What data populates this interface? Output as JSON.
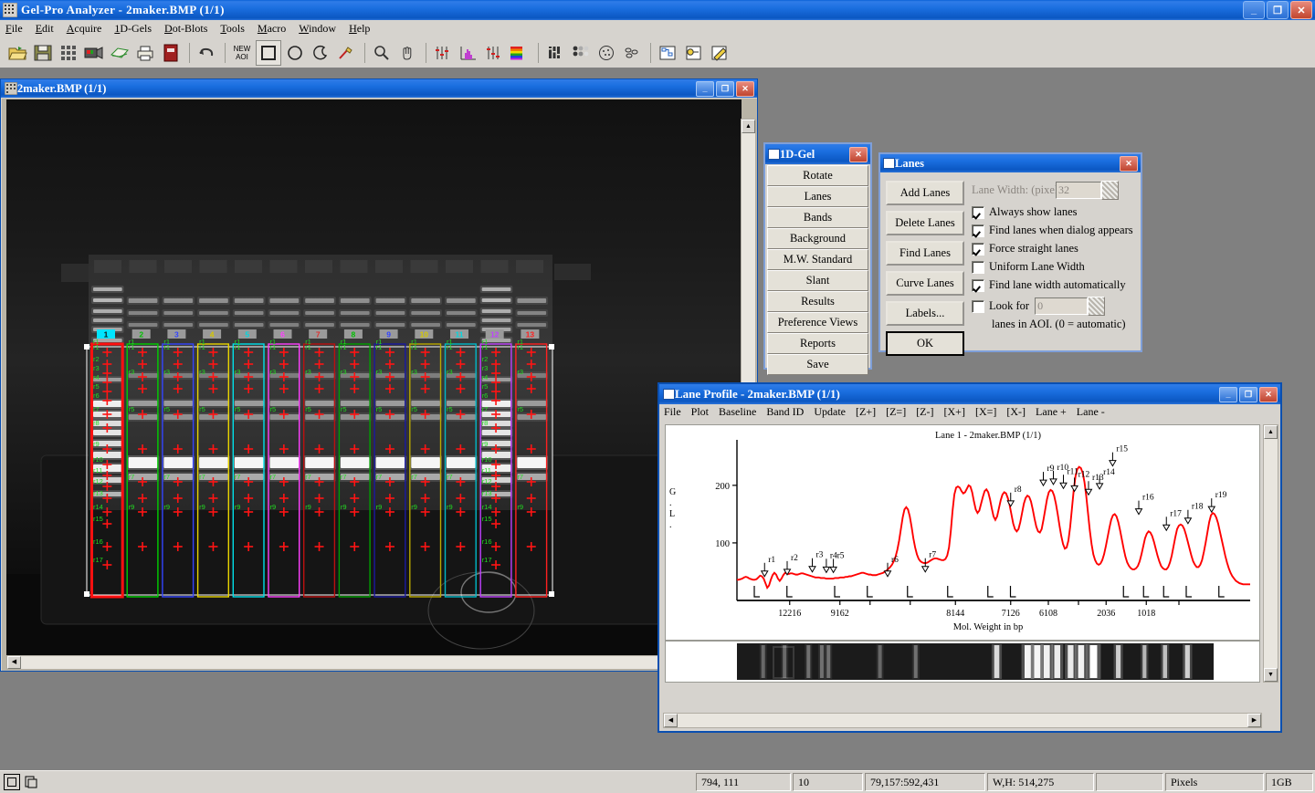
{
  "app": {
    "title": "Gel-Pro Analyzer - 2maker.BMP (1/1)",
    "icon": "gel-app-icon",
    "window_buttons": {
      "minimize": "_",
      "restore": "❐",
      "close": "✕"
    },
    "menu": [
      "File",
      "Edit",
      "Acquire",
      "1D-Gels",
      "Dot-Blots",
      "Tools",
      "Macro",
      "Window",
      "Help"
    ],
    "toolbar": [
      {
        "name": "open-icon",
        "glyph": "📂"
      },
      {
        "name": "save-icon",
        "glyph": "💾"
      },
      {
        "name": "grid-icon",
        "glyph": "▒"
      },
      {
        "name": "camera-icon",
        "glyph": "📷"
      },
      {
        "name": "scanner-icon",
        "glyph": "▱"
      },
      {
        "name": "print-icon",
        "glyph": "🖶"
      },
      {
        "name": "book-icon",
        "glyph": "📕"
      },
      {
        "name": "undo-icon",
        "glyph": "↩"
      },
      {
        "name": "new-aoi-icon",
        "glyph": "NEW AOI"
      },
      {
        "name": "rect-aoi-icon",
        "glyph": "□"
      },
      {
        "name": "ellipse-aoi-icon",
        "glyph": "◯"
      },
      {
        "name": "irregular-aoi-icon",
        "glyph": "☾"
      },
      {
        "name": "freehand-aoi-icon",
        "glyph": "✎"
      },
      {
        "name": "zoom-icon",
        "glyph": "🔍"
      },
      {
        "name": "pan-hand-icon",
        "glyph": "✋"
      },
      {
        "name": "contrast-icon",
        "glyph": "↕"
      },
      {
        "name": "histogram-icon",
        "glyph": "░"
      },
      {
        "name": "levels-icon",
        "glyph": "↕"
      },
      {
        "name": "lut-color-icon",
        "glyph": "☰"
      },
      {
        "name": "1d-gel-icon",
        "glyph": "▓"
      },
      {
        "name": "dot-blot-icon",
        "glyph": "⚫"
      },
      {
        "name": "colony-count-icon",
        "glyph": "◎"
      },
      {
        "name": "object-count-icon",
        "glyph": "◌"
      },
      {
        "name": "macro-icon",
        "glyph": "⌗"
      },
      {
        "name": "script-icon",
        "glyph": "📝"
      },
      {
        "name": "annotate-icon",
        "glyph": "✏"
      }
    ]
  },
  "gel_window": {
    "title": "2maker.BMP  (1/1)",
    "icon": "image-document-icon",
    "buttons": {
      "minimize": "_",
      "restore": "❐",
      "close": "✕"
    },
    "lane_labels": [
      "1",
      "2",
      "3",
      "4",
      "5",
      "6",
      "7",
      "8",
      "9",
      "10",
      "11",
      "12",
      "13"
    ],
    "lane_label_colors": [
      "#00e5ff",
      "#00c000",
      "#3344ff",
      "#d6c800",
      "#00d8e0",
      "#ff40ff",
      "#e03030",
      "#00c000",
      "#3344ff",
      "#d6c800",
      "#00d8e0",
      "#c040ff",
      "#ff2020"
    ],
    "lane_outline_colors": [
      "#ff1010",
      "#00d000",
      "#3344ff",
      "#e8d400",
      "#00e0ea",
      "#ff40ff",
      "#bb1010",
      "#00a000",
      "#1a1aa0",
      "#b8a800",
      "#00b8c8",
      "#c040ff",
      "#ff2020"
    ],
    "selected_lane": 1,
    "band_tag_prefix": "r"
  },
  "gel_dialog": {
    "title": "1D-Gel",
    "icon": "dialog-icon",
    "close": "✕",
    "buttons": [
      "Rotate",
      "Lanes",
      "Bands",
      "Background",
      "M.W. Standard",
      "Slant",
      "Results",
      "Preference Views",
      "Reports",
      "Save"
    ]
  },
  "lanes_dialog": {
    "title": "Lanes",
    "icon": "dialog-icon",
    "close": "✕",
    "buttons": [
      "Add Lanes",
      "Delete Lanes",
      "Find Lanes",
      "Curve Lanes",
      "Labels...",
      "OK"
    ],
    "lane_width_label": "Lane Width:  (pixels)",
    "lane_width_value": "32",
    "checkboxes": [
      {
        "label": "Always show lanes",
        "checked": true
      },
      {
        "label": "Find lanes when dialog appears",
        "checked": true
      },
      {
        "label": "Force straight lanes",
        "checked": true
      },
      {
        "label": "Uniform Lane Width",
        "checked": false
      },
      {
        "label": "Find lane width automatically",
        "checked": true
      },
      {
        "label": "Look for",
        "checked": false
      }
    ],
    "look_for_value": "0",
    "aoi_note": "lanes in AOI.  (0 = automatic)"
  },
  "lane_profile": {
    "title": "Lane Profile - 2maker.BMP (1/1)",
    "icon": "profile-icon",
    "buttons": {
      "minimize": "_",
      "restore": "❐",
      "close": "✕"
    },
    "menu": [
      "File",
      "Plot",
      "Baseline",
      "Band ID",
      "Update",
      "[Z+]",
      "[Z=]",
      "[Z-]",
      "[X+]",
      "[X=]",
      "[X-]",
      "Lane +",
      "Lane -"
    ]
  },
  "chart_data": {
    "type": "line",
    "title": "Lane 1 - 2maker.BMP  (1/1)",
    "xlabel": "Mol. Weight in bp",
    "ylabel": "G.L.",
    "ylim": [
      0,
      260
    ],
    "yticks": [
      100,
      200
    ],
    "xtick_labels": [
      "12216",
      "9162",
      "8144",
      "7126",
      "6108",
      "2036",
      "1018"
    ],
    "xtick_positions": [
      0.105,
      0.205,
      0.435,
      0.545,
      0.62,
      0.735,
      0.815
    ],
    "grid": false,
    "legend": null,
    "series_color": "#ff0000",
    "peaks": [
      {
        "id": "r1",
        "x": 0.055,
        "y": 40
      },
      {
        "id": "r2",
        "x": 0.1,
        "y": 43
      },
      {
        "id": "r3",
        "x": 0.15,
        "y": 48
      },
      {
        "id": "r4",
        "x": 0.178,
        "y": 47
      },
      {
        "id": "r5",
        "x": 0.192,
        "y": 47
      },
      {
        "id": "r6",
        "x": 0.3,
        "y": 40
      },
      {
        "id": "r7",
        "x": 0.375,
        "y": 48
      },
      {
        "id": "r8",
        "x": 0.545,
        "y": 162
      },
      {
        "id": "r9",
        "x": 0.61,
        "y": 198
      },
      {
        "id": "r10",
        "x": 0.63,
        "y": 200
      },
      {
        "id": "r11",
        "x": 0.65,
        "y": 193
      },
      {
        "id": "r12",
        "x": 0.672,
        "y": 188
      },
      {
        "id": "r13",
        "x": 0.7,
        "y": 182
      },
      {
        "id": "r14",
        "x": 0.722,
        "y": 192
      },
      {
        "id": "r15",
        "x": 0.748,
        "y": 232
      },
      {
        "id": "r16",
        "x": 0.8,
        "y": 148
      },
      {
        "id": "r17",
        "x": 0.855,
        "y": 120
      },
      {
        "id": "r18",
        "x": 0.898,
        "y": 132
      },
      {
        "id": "r19",
        "x": 0.945,
        "y": 152
      }
    ],
    "values": [
      36,
      36,
      37,
      38,
      40,
      41,
      40,
      38,
      37,
      36,
      36,
      37,
      40,
      43,
      42,
      38,
      30,
      22,
      26,
      36,
      44,
      48,
      45,
      38,
      34,
      38,
      44,
      48,
      47,
      46,
      47,
      47,
      46,
      45,
      45,
      46,
      47,
      47,
      46,
      45,
      44,
      43,
      42,
      41,
      40,
      40,
      40,
      39,
      39,
      39,
      38,
      38,
      38,
      38,
      38,
      39,
      39,
      39,
      40,
      40,
      40,
      41,
      41,
      42,
      42,
      43,
      44,
      45,
      46,
      47,
      48,
      48,
      47,
      46,
      45,
      45,
      44,
      44,
      44,
      45,
      46,
      47,
      48,
      50,
      52,
      55,
      58,
      62,
      68,
      76,
      88,
      104,
      124,
      144,
      158,
      162,
      158,
      146,
      128,
      108,
      92,
      80,
      72,
      68,
      66,
      65,
      65,
      66,
      68,
      70,
      72,
      73,
      73,
      72,
      71,
      70,
      70,
      72,
      78,
      92,
      120,
      156,
      184,
      196,
      198,
      196,
      190,
      186,
      188,
      194,
      200,
      198,
      188,
      172,
      158,
      152,
      156,
      168,
      180,
      190,
      193,
      188,
      176,
      160,
      146,
      140,
      146,
      160,
      174,
      184,
      188,
      186,
      178,
      166,
      150,
      134,
      124,
      120,
      124,
      136,
      152,
      168,
      178,
      182,
      180,
      172,
      158,
      142,
      128,
      120,
      118,
      124,
      140,
      158,
      176,
      188,
      192,
      190,
      182,
      168,
      150,
      130,
      112,
      98,
      90,
      92,
      104,
      128,
      160,
      192,
      216,
      228,
      232,
      230,
      222,
      206,
      182,
      152,
      122,
      98,
      80,
      70,
      64,
      62,
      64,
      70,
      80,
      94,
      110,
      126,
      140,
      148,
      150,
      146,
      136,
      122,
      106,
      90,
      76,
      66,
      60,
      56,
      54,
      54,
      56,
      60,
      68,
      80,
      94,
      108,
      116,
      120,
      118,
      112,
      102,
      90,
      78,
      68,
      60,
      56,
      54,
      54,
      58,
      66,
      78,
      94,
      110,
      124,
      130,
      132,
      130,
      124,
      114,
      102,
      90,
      78,
      68,
      62,
      58,
      58,
      62,
      70,
      84,
      100,
      118,
      136,
      148,
      152,
      150,
      144,
      134,
      120,
      106,
      92,
      78,
      66,
      56,
      48,
      42,
      38,
      34,
      32,
      30,
      29,
      28,
      28,
      28,
      28,
      28
    ]
  },
  "status_bar": {
    "icons": [
      "select-tool-icon",
      "page-tool-icon"
    ],
    "cells": [
      "794, 111",
      "10",
      "79,157:592,431",
      "W,H: 514,275",
      "",
      "Pixels",
      "1GB"
    ]
  }
}
